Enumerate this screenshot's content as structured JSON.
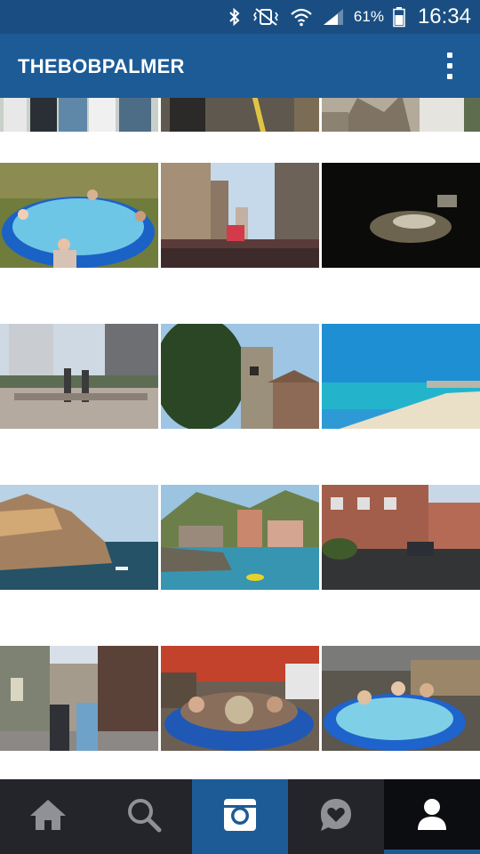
{
  "status_bar": {
    "battery_percent": "61%",
    "time": "16:34",
    "icons": [
      "bluetooth-icon",
      "vibrate-mute-icon",
      "wifi-icon",
      "cell-signal-icon",
      "battery-icon"
    ]
  },
  "header": {
    "username": "THEBOBPALMER",
    "menu_icon": "overflow-menu-icon"
  },
  "grid": {
    "photos": [
      {
        "subject": "people standing, cropped"
      },
      {
        "subject": "street with yellow line, cropped"
      },
      {
        "subject": "stone building ornament, cropped"
      },
      {
        "subject": "inflatable pool on grass"
      },
      {
        "subject": "crowd on city street"
      },
      {
        "subject": "dark concert crowd"
      },
      {
        "subject": "statues on plaza"
      },
      {
        "subject": "church tower and tree"
      },
      {
        "subject": "beach and sea"
      },
      {
        "subject": "cliff village by sea"
      },
      {
        "subject": "harbour with colourful houses"
      },
      {
        "subject": "terraced street with cars"
      },
      {
        "subject": "narrow old street with people"
      },
      {
        "subject": "hot tub with people"
      },
      {
        "subject": "inflatable pool in yard"
      }
    ]
  },
  "bottom_nav": {
    "items": [
      {
        "icon": "home-icon",
        "state": "inactive"
      },
      {
        "icon": "search-icon",
        "state": "inactive"
      },
      {
        "icon": "camera-icon",
        "state": "highlighted"
      },
      {
        "icon": "activity-heart-icon",
        "state": "inactive"
      },
      {
        "icon": "profile-icon",
        "state": "selected"
      }
    ]
  },
  "colors": {
    "status_bar": "#1a4e82",
    "header": "#1d5b96",
    "nav_background": "#23252a",
    "nav_selected": "#0c0d10",
    "accent": "#1d5b96"
  }
}
